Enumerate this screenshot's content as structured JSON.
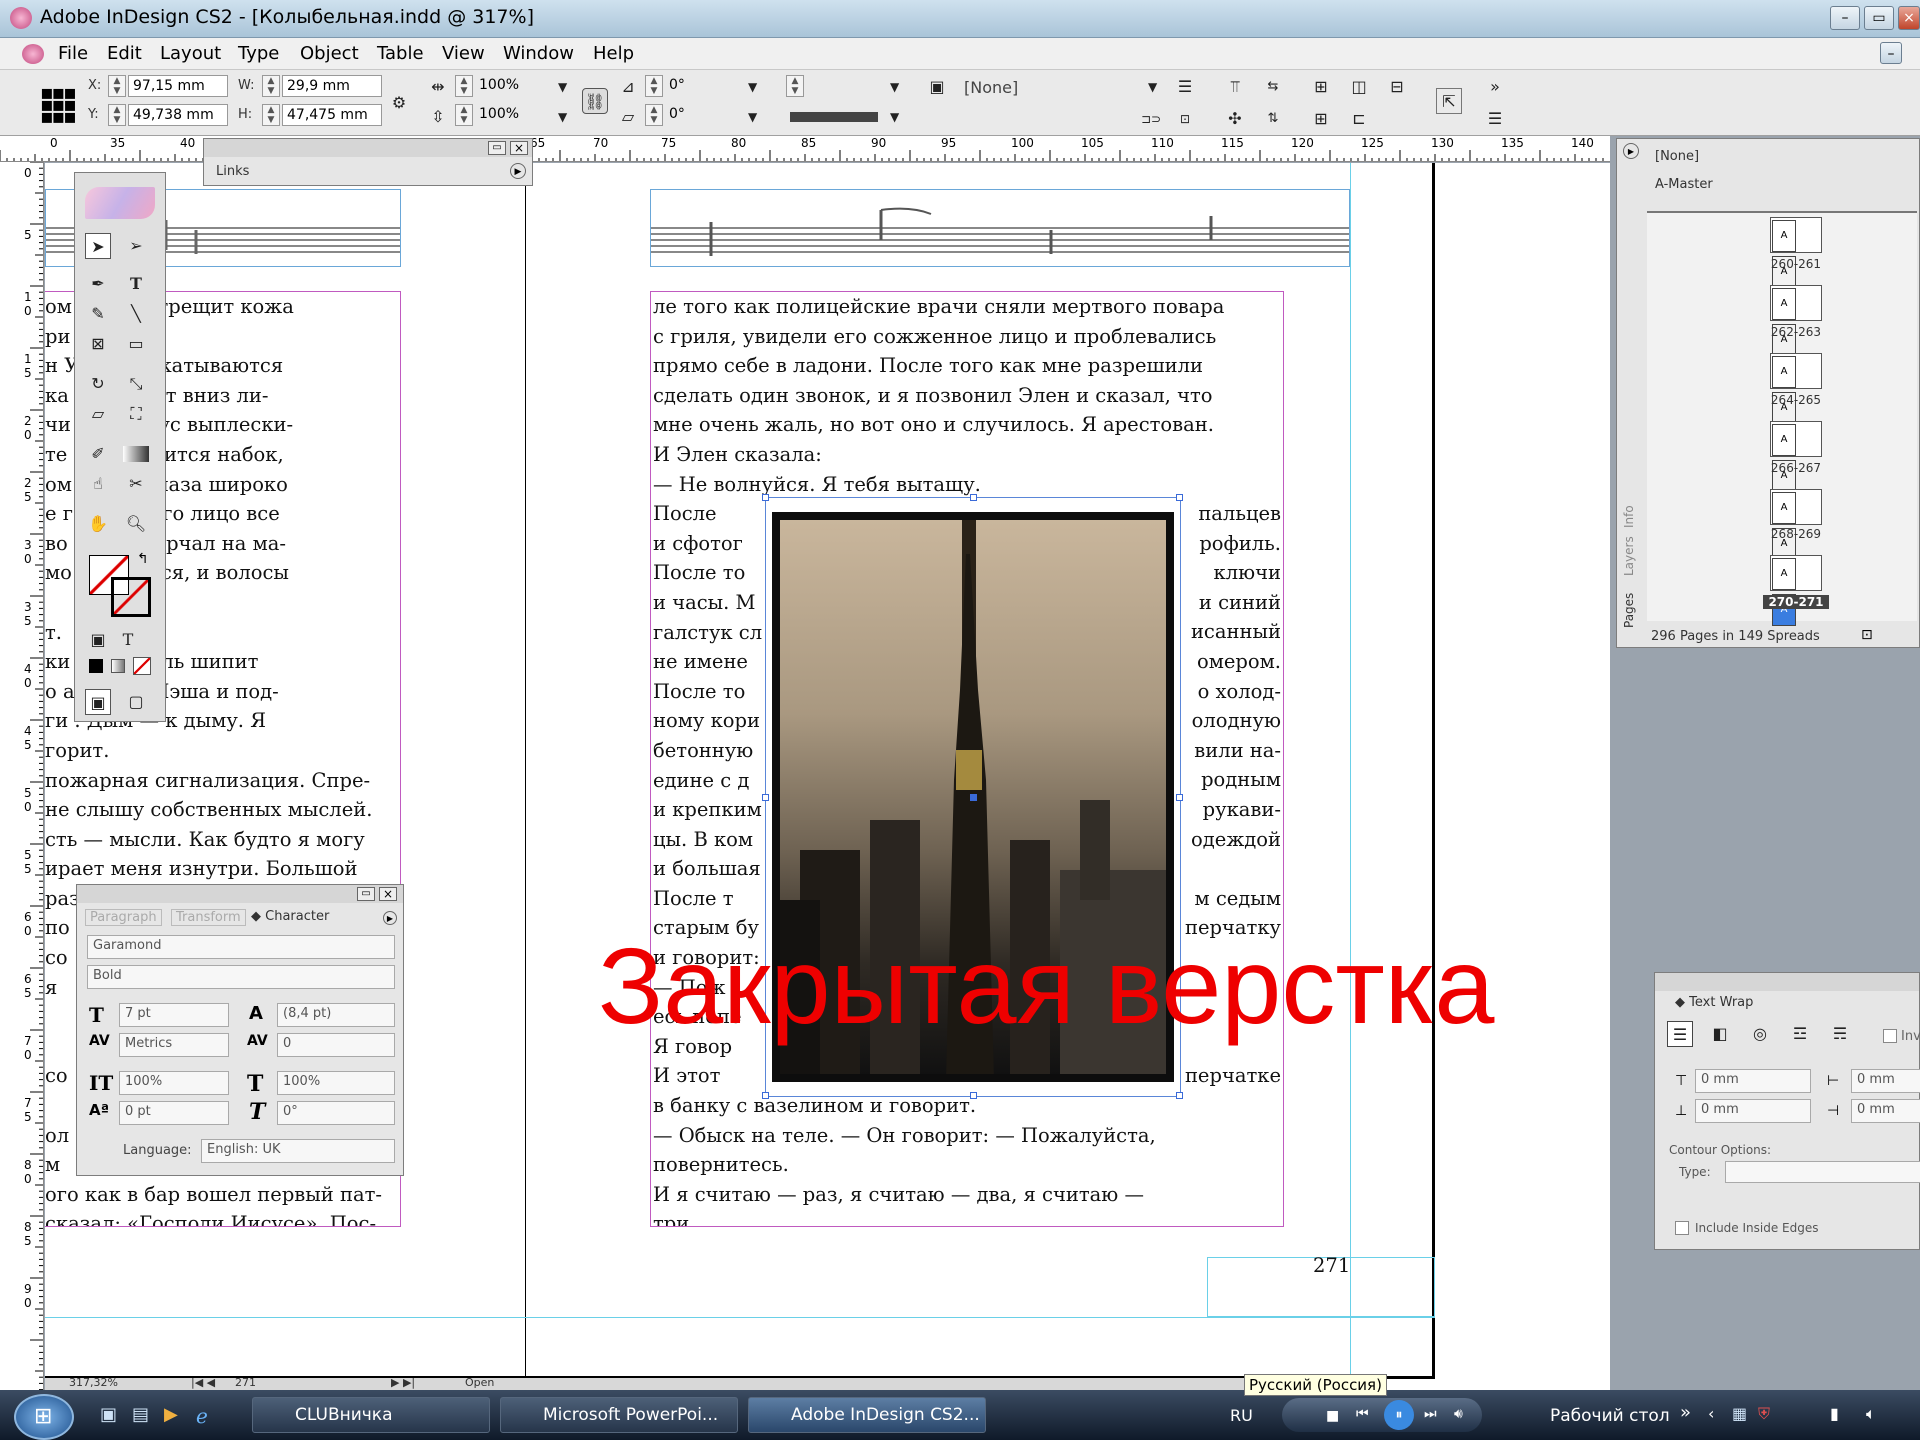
{
  "window": {
    "title": "Adobe InDesign CS2 - [Колыбельная.indd @ 317%]"
  },
  "menu": [
    "File",
    "Edit",
    "Layout",
    "Type",
    "Object",
    "Table",
    "View",
    "Window",
    "Help"
  ],
  "control_panel": {
    "x_label": "X:",
    "x_value": "97,15 mm",
    "y_label": "Y:",
    "y_value": "49,738 mm",
    "w_label": "W:",
    "w_value": "29,9 mm",
    "h_label": "H:",
    "h_value": "47,475 mm",
    "scale_x": "100%",
    "scale_y": "100%",
    "rotate": "0°",
    "shear": "0°",
    "object_style": "[None]"
  },
  "ruler": {
    "h_labels": [
      "0",
      "35",
      "40",
      "65",
      "70",
      "75",
      "80",
      "85",
      "90",
      "95",
      "100",
      "105",
      "110",
      "115",
      "120",
      "125",
      "130",
      "135",
      "140"
    ],
    "v_labels": [
      "0",
      "5",
      "1 0",
      "1 5",
      "2 0",
      "2 5",
      "3 0",
      "3 5",
      "4 0",
      "4 5",
      "5 0",
      "5 5",
      "6 0",
      "6 5",
      "7 0",
      "7 5",
      "8 0",
      "8 5",
      "9 0"
    ]
  },
  "links_panel": {
    "title": "Links"
  },
  "left_page_lines": [
    "ом            но, как трещит кожа",
    "ри           гриле.",
    " н           У него закатываются",
    "ка             он падает вниз ли-",
    "чи         сный соус выплески-",
    " те        енно валится набок,",
    "ом          й. Его глаза широко",
    "е г          глаза. Его лицо все",
    "во         торый торчал на ма-",
    "мо         стрепался, и волосы",
    "",
    "т.",
    "ки          еня, гриль шипит",
    "о          арточку Нэша и под-",
    "ги           . Дым — к дыму. Я",
    "горит.",
    "пожарная сигнализация. Спре-",
    "не слышу собственных мыслей.",
    "сть — мысли. Как будто я могу",
    "ирает меня изнутри. Большой",
    "раз",
    "по",
    "со",
    " я",
    "",
    "",
    "со",
    "",
    "ол",
    " м",
    "ого как в бар вошел первый пат-",
    "сказал: «Господи Иисусе». Пос-"
  ],
  "right_page_lines": [
    "ле того как полицейские врачи сняли мертвого повара",
    "с гриля, увидели его сожженное лицо и проблевались",
    "прямо себе в ладони. После того как мне разрешили",
    "сделать один звонок, и я позвонил Элен и сказал, что",
    "мне очень жаль, но вот оно и случилось. Я арестован.",
    "И Элен сказала:",
    "   — Не волнуйся. Я тебя вытащу.",
    "   После",
    "и сфотог",
    "После то",
    "и часы. М",
    "галстук сл",
    "не имене",
    "После то",
    "ному кори",
    "бетонную",
    "едине с д",
    "и крепким",
    "цы. В ком",
    "и большая",
    "   После т",
    "старым бу",
    "и говорит:",
    "   — Пож",
    "есь попе",
    "   Я говор",
    "   И этот",
    "в банку с вазелином и говорит.",
    "   — Обыск на теле. — Он говорит: — Пожалуйста,",
    "повернитесь.",
    "   И я считаю — раз, я считаю — два, я считаю —",
    "три..."
  ],
  "right_page_right_fragments": [
    "пальцев",
    "рофиль.",
    "ключи",
    "и синий",
    "исанный",
    "омером.",
    "о холод-",
    "олодную",
    "вили на-",
    "родным",
    "рукави-",
    "одеждой",
    "",
    "м седым",
    "перчатку",
    "",
    "",
    "",
    "",
    "перчатке"
  ],
  "page_number": "271",
  "watermark": "Закрытая верстка",
  "character_panel": {
    "tabs": [
      "Paragraph",
      "Transform",
      "Character"
    ],
    "font": "Garamond",
    "style": "Bold",
    "size": "7 pt",
    "leading": "(8,4 pt)",
    "kerning": "Metrics",
    "tracking": "0",
    "vscale": "100%",
    "hscale": "100%",
    "baseline": "0 pt",
    "skew": "0°",
    "language_label": "Language:",
    "language": "English: UK"
  },
  "pages_panel": {
    "none_label": "[None]",
    "master_label": "A-Master",
    "spreads": [
      "260-261",
      "262-263",
      "264-265",
      "266-267",
      "268-269",
      "270-271"
    ],
    "side_tabs": [
      "Info",
      "Layers",
      "Pages"
    ],
    "status": "296 Pages in 149 Spreads"
  },
  "text_wrap_panel": {
    "title": "Text Wrap",
    "invert_label": "Inv",
    "offsets": [
      "0 mm",
      "0 mm",
      "0 mm",
      "0 mm"
    ],
    "contour_label": "Contour Options:",
    "type_label": "Type:",
    "include_label": "Include Inside Edges"
  },
  "status_bar": {
    "zoom": "317,32%",
    "page": "271",
    "open_label": "Open"
  },
  "taskbar": {
    "buttons": [
      "CLUBничка",
      "Microsoft PowerPoi...",
      "Adobe InDesign CS2..."
    ],
    "lang": "RU",
    "lang_tooltip": "Русский (Россия)",
    "desktop": "Рабочий стол"
  }
}
